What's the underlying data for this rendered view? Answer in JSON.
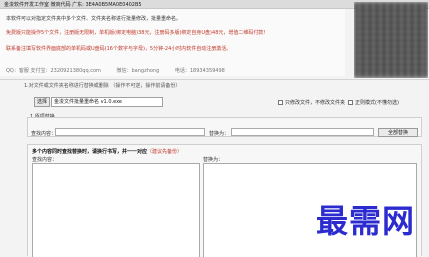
{
  "header": {
    "title": "金浚软件开发工作室 微商代码 广东: 3E4A0B5MA0E0402B5"
  },
  "info": {
    "lines": [
      "本软件可以对指定文件夹中多个文件、文件夹名称进行批量修改，批量重命名。",
      "免费版只能操作5个文件，注册版无限制，单机版(绑定电脑)38元，注册码多版(绑定自身U盘)48元，增值二维码付款！",
      "联系备注填写软件界面底部的单机码或U盘码(16个数字与字母)，5分钟-24小时内软件自动注册激活。"
    ],
    "contact": {
      "qq": "QQ：客服  支付宝：2320921380qq.com",
      "wechat": "微信：bangzhong",
      "phone": "电话：18934359498"
    }
  },
  "mode_label": "1.对文件或文件夹名称进行替换或删除 （操作不可逆，操作前请备份）",
  "toolbar": {
    "select_label": "选择",
    "file_name": "金浚文件批量重命名 v1.0.exe",
    "option_include_folders": "只修改文件，不修改文件夹",
    "option_regex": "正则模式(不懂勿选)"
  },
  "single_replace": {
    "section_label": "1.逐项替换",
    "find_label": "查找内容：",
    "replace_label": "替换为：",
    "find_value": "",
    "replace_value": "",
    "replace_all_label": "全部替换"
  },
  "multi_replace": {
    "title": "多个内容同时查找替换时，请换行书写，并一一对应",
    "note": "（建议先备份）",
    "find_label": "查找内容：",
    "replace_label": "替换为："
  },
  "watermark": "最需网"
}
